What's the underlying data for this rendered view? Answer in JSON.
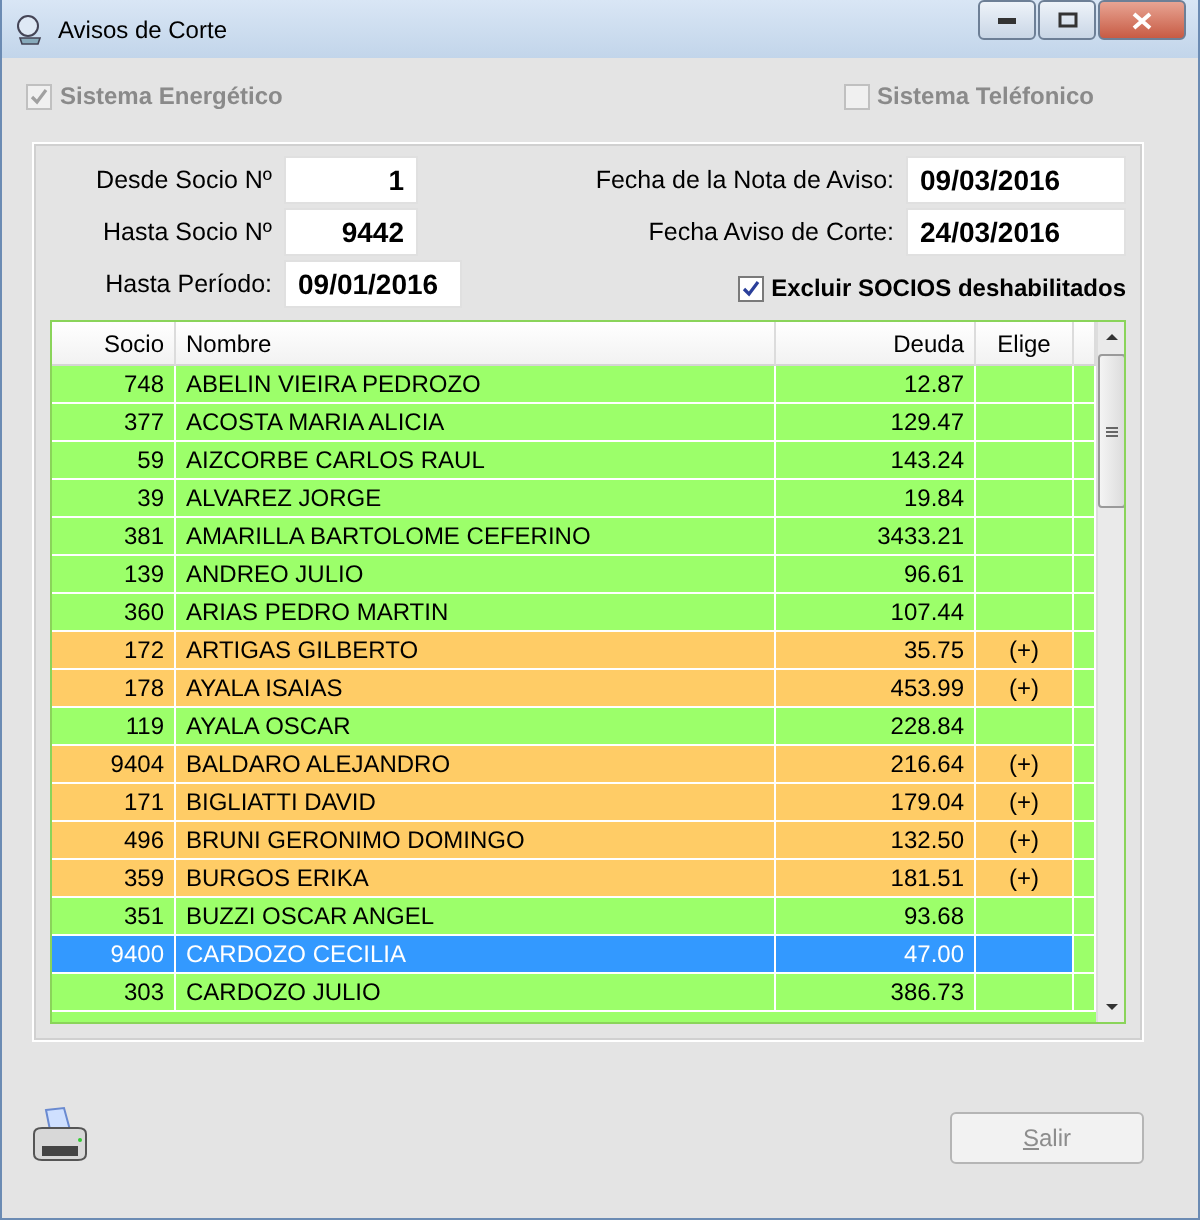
{
  "window": {
    "title": "Avisos de Corte"
  },
  "systems": [
    {
      "label": "Sistema Energético",
      "checked": true,
      "disabled": true
    },
    {
      "label": "Sistema Teléfonico",
      "checked": false,
      "disabled": true
    }
  ],
  "left_fields": [
    {
      "label": "Desde Socio Nº",
      "value": "1",
      "kind": "number"
    },
    {
      "label": "Hasta Socio Nº",
      "value": "9442",
      "kind": "number"
    },
    {
      "label": "Hasta Período:",
      "value": "09/01/2016",
      "kind": "date"
    }
  ],
  "right_fields": [
    {
      "label": "Fecha de la Nota de Aviso:",
      "value": "09/03/2016"
    },
    {
      "label": "Fecha Aviso de Corte:",
      "value": "24/03/2016"
    }
  ],
  "exclude": {
    "label": "Excluir SOCIOS deshabilitados",
    "checked": true
  },
  "table": {
    "columns": [
      "Socio",
      "Nombre",
      "Deuda",
      "Elige"
    ],
    "rows": [
      {
        "socio": "748",
        "nombre": "ABELIN VIEIRA PEDROZO",
        "deuda": "12.87",
        "kind": "ok",
        "selected": false
      },
      {
        "socio": "377",
        "nombre": "ACOSTA MARIA ALICIA",
        "deuda": "129.47",
        "kind": "ok",
        "selected": false
      },
      {
        "socio": "59",
        "nombre": "AIZCORBE CARLOS RAUL",
        "deuda": "143.24",
        "kind": "ok",
        "selected": false
      },
      {
        "socio": "39",
        "nombre": "ALVAREZ JORGE",
        "deuda": "19.84",
        "kind": "ok",
        "selected": false
      },
      {
        "socio": "381",
        "nombre": "AMARILLA BARTOLOME CEFERINO",
        "deuda": "3433.21",
        "kind": "ok",
        "selected": false
      },
      {
        "socio": "139",
        "nombre": "ANDREO JULIO",
        "deuda": "96.61",
        "kind": "ok",
        "selected": false
      },
      {
        "socio": "360",
        "nombre": "ARIAS PEDRO MARTIN",
        "deuda": "107.44",
        "kind": "ok",
        "selected": false
      },
      {
        "socio": "172",
        "nombre": "ARTIGAS GILBERTO",
        "deuda": "35.75",
        "elige": "(+)",
        "kind": "warn",
        "selected": false
      },
      {
        "socio": "178",
        "nombre": "AYALA ISAIAS",
        "deuda": "453.99",
        "elige": "(+)",
        "kind": "warn",
        "selected": false
      },
      {
        "socio": "119",
        "nombre": "AYALA OSCAR",
        "deuda": "228.84",
        "kind": "ok",
        "selected": false
      },
      {
        "socio": "9404",
        "nombre": "BALDARO ALEJANDRO",
        "deuda": "216.64",
        "elige": "(+)",
        "kind": "warn",
        "selected": false
      },
      {
        "socio": "171",
        "nombre": "BIGLIATTI DAVID",
        "deuda": "179.04",
        "elige": "(+)",
        "kind": "warn",
        "selected": false
      },
      {
        "socio": "496",
        "nombre": "BRUNI GERONIMO DOMINGO",
        "deuda": "132.50",
        "elige": "(+)",
        "kind": "warn",
        "selected": false
      },
      {
        "socio": "359",
        "nombre": "BURGOS ERIKA",
        "deuda": "181.51",
        "elige": "(+)",
        "kind": "warn",
        "selected": false
      },
      {
        "socio": "351",
        "nombre": "BUZZI OSCAR ANGEL",
        "deuda": "93.68",
        "kind": "ok",
        "selected": false
      },
      {
        "socio": "9400",
        "nombre": "CARDOZO CECILIA",
        "deuda": "47.00",
        "kind": "ok",
        "selected": true
      },
      {
        "socio": "303",
        "nombre": "CARDOZO JULIO",
        "deuda": "386.73",
        "kind": "ok",
        "selected": false
      }
    ]
  },
  "buttons": [
    {
      "label": "Salir",
      "disabled": true
    }
  ]
}
